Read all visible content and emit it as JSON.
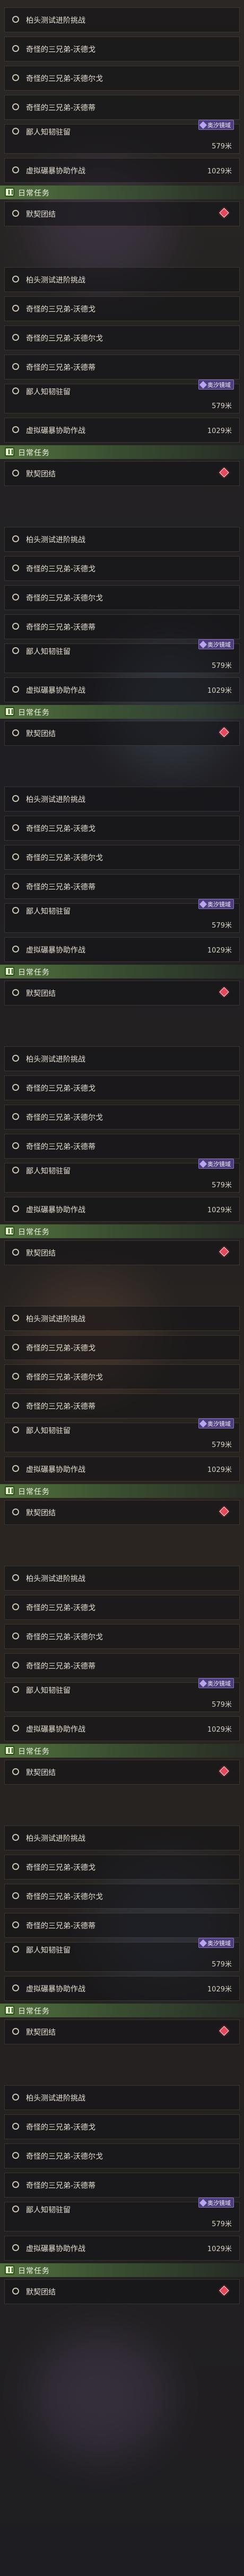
{
  "daily_header": {
    "title": "日常任务",
    "icon": "daily-quest-book-icon"
  },
  "quests": {
    "q1": "柏头测试进阶挑战",
    "q2": "奇怪的三兄弟-沃德戈",
    "q3": "奇怪的三兄弟-沃德尔戈",
    "q4": "奇怪的三兄弟-沃德蒂",
    "q5": "鄙人知韧驻留",
    "q6": "虚拟碾暴协助作战",
    "q7": "默契团结"
  },
  "distances": {
    "q5": "579米",
    "q6": "1029米"
  },
  "tag": {
    "label": "奥汐镜域",
    "icon": "dimension-tag-icon"
  },
  "colors": {
    "accent_green": "#567640",
    "tag_purple": "#4e3d7c",
    "marker_red": "#e4485a"
  }
}
